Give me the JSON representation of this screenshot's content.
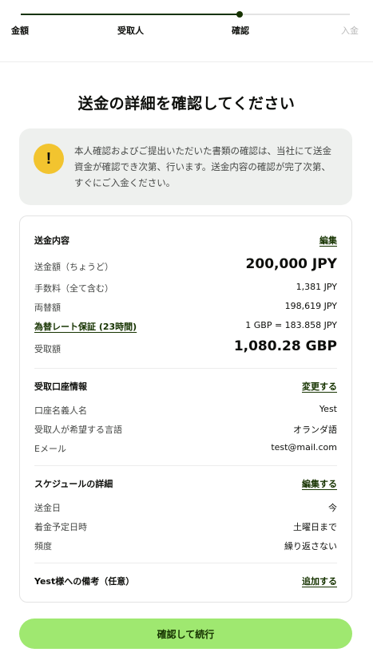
{
  "progress": {
    "steps": [
      "金額",
      "受取人",
      "確認",
      "入金"
    ],
    "current_step": 3
  },
  "title": "送金の詳細を確認してください",
  "notice": {
    "icon": "exclamation-icon",
    "text": "本人確認およびご提出いただいた書類の確認は、当社にて送金資金が確認でき次第、行います。送金内容の確認が完了次第、すぐにご入金ください。"
  },
  "transfer": {
    "heading": "送金内容",
    "edit_label": "編集",
    "rows": [
      {
        "label": "送金額（ちょうど）",
        "value": "200,000 JPY"
      },
      {
        "label": "手数料（全て含む）",
        "value": "1,381 JPY"
      },
      {
        "label": "両替額",
        "value": "198,619 JPY"
      },
      {
        "label": "為替レート保証 (23時間)",
        "value": "1 GBP = 183.858 JPY"
      },
      {
        "label": "受取額",
        "value": "1,080.28 GBP"
      }
    ]
  },
  "recipient": {
    "heading": "受取口座情報",
    "change_label": "変更する",
    "rows": [
      {
        "label": "口座名義人名",
        "value": "Yest"
      },
      {
        "label": "受取人が希望する言語",
        "value": "オランダ語"
      },
      {
        "label": "Eメール",
        "value": "test@mail.com"
      }
    ]
  },
  "schedule": {
    "heading": "スケジュールの詳細",
    "edit_label": "編集する",
    "rows": [
      {
        "label": "送金日",
        "value": "今"
      },
      {
        "label": "着金予定日時",
        "value": "土曜日まで"
      },
      {
        "label": "頻度",
        "value": "繰り返さない"
      }
    ]
  },
  "note": {
    "heading": "Yest様への備考（任意）",
    "add_label": "追加する"
  },
  "confirm_button": "確認して続行",
  "colors": {
    "accent_dark": "#163300",
    "button_green": "#9fe870",
    "warning_yellow": "#f2c42f",
    "notice_bg": "#eef0ee"
  }
}
